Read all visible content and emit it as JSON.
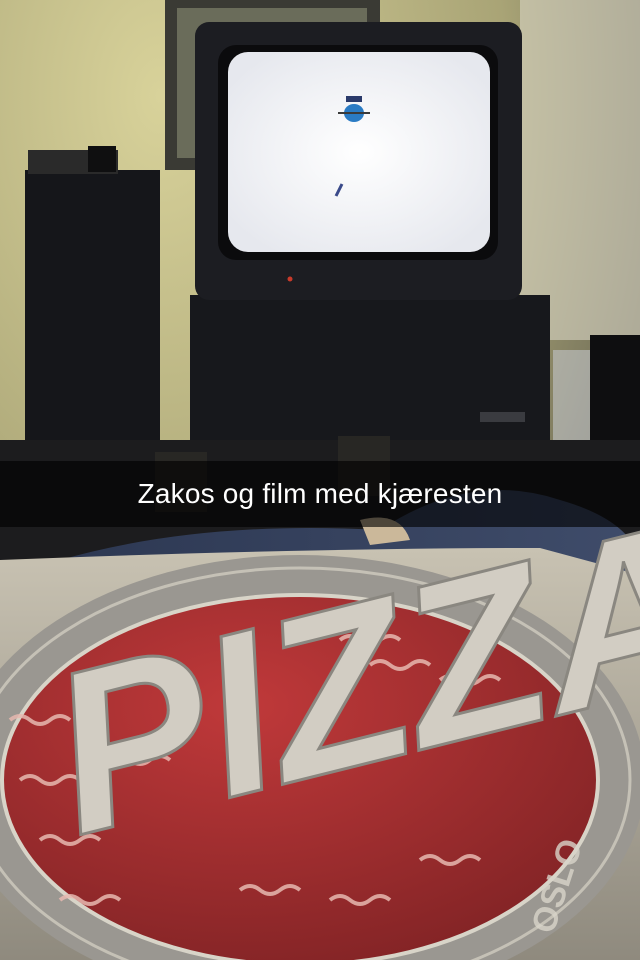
{
  "caption": {
    "text": "Zakos og film med kjæresten"
  },
  "pizza_box_print": {
    "logo_word": "PIZZA",
    "rim_text": "OSLO"
  },
  "colors": {
    "wall": "#c9c18a",
    "tv_screen": "#f4f4f6",
    "tv_body": "#1c1d22",
    "pizza_red": "#a32d2e",
    "box_cardboard": "#c9c4b4",
    "caption_bar": "#000000"
  }
}
